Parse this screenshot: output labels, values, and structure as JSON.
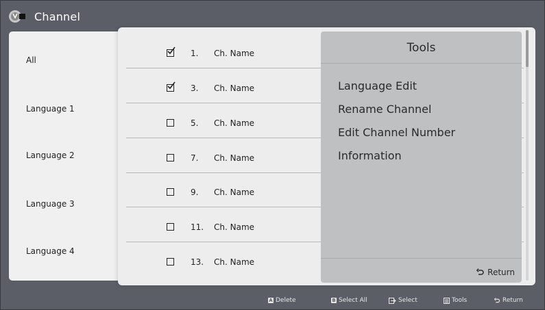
{
  "header": {
    "title": "Channel",
    "icon": "tv-channel-icon"
  },
  "categories": [
    {
      "label": "All"
    },
    {
      "label": "Language 1"
    },
    {
      "label": "Language 2"
    },
    {
      "label": "Language 3"
    },
    {
      "label": "Language 4"
    }
  ],
  "channels": [
    {
      "number": "1.",
      "name": "Ch. Name",
      "checked": true
    },
    {
      "number": "3.",
      "name": "Ch. Name",
      "checked": true
    },
    {
      "number": "5.",
      "name": "Ch. Name",
      "checked": false
    },
    {
      "number": "7.",
      "name": "Ch. Name",
      "checked": false
    },
    {
      "number": "9.",
      "name": "Ch. Name",
      "checked": false
    },
    {
      "number": "11.",
      "name": "Ch. Name",
      "checked": false
    },
    {
      "number": "13.",
      "name": "Ch. Name",
      "checked": false
    }
  ],
  "tools": {
    "title": "Tools",
    "items": [
      {
        "label": "Language Edit"
      },
      {
        "label": "Rename Channel"
      },
      {
        "label": "Edit Channel Number"
      },
      {
        "label": "Information"
      }
    ],
    "return_label": "Return"
  },
  "hints": [
    {
      "key": "A",
      "label": "Delete"
    },
    {
      "key": "B",
      "label": "Select All"
    },
    {
      "key": "",
      "label": "Select",
      "icon": "enter-icon"
    },
    {
      "key": "",
      "label": "Tools",
      "icon": "tools-icon"
    },
    {
      "key": "",
      "label": "Return",
      "icon": "return-icon"
    }
  ],
  "colors": {
    "background": "#5b5e66",
    "panel": "#ededed",
    "tools_popup": "#bfc0c2"
  }
}
